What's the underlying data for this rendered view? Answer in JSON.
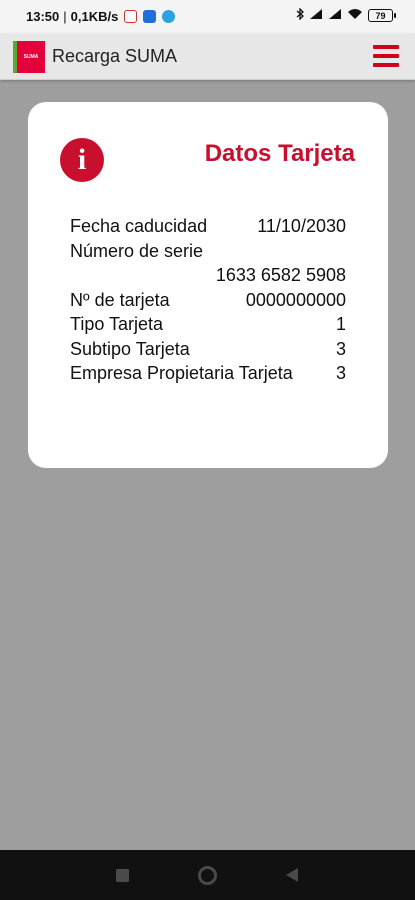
{
  "status_bar": {
    "time": "13:50",
    "separator": "|",
    "speed": "0,1KB/s",
    "battery": "79",
    "icons": [
      "gmail-icon",
      "outlook-icon",
      "telegram-icon",
      "bluetooth-icon",
      "signal-icon",
      "signal-icon",
      "wifi-icon",
      "battery-icon"
    ]
  },
  "app_bar": {
    "logo_text": "SUMA",
    "title": "Recarga SUMA",
    "menu_icon": "hamburger-menu-icon"
  },
  "card": {
    "icon": "info-icon",
    "icon_glyph": "i",
    "title": "Datos Tarjeta",
    "rows": [
      {
        "label": "Fecha caducidad",
        "value": "11/10/2030"
      },
      {
        "label": "Número de serie",
        "value": ""
      },
      {
        "label": "",
        "value": "1633 6582 5908"
      },
      {
        "label": "Nº de tarjeta",
        "value": "0000000000"
      },
      {
        "label": "Tipo Tarjeta",
        "value": "1"
      },
      {
        "label": "Subtipo Tarjeta",
        "value": "3"
      },
      {
        "label": "Empresa Propietaria Tarjeta",
        "value": "3"
      }
    ]
  },
  "colors": {
    "accent": "#c8102e",
    "background": "#9e9e9e",
    "card": "#ffffff",
    "app_bar": "#e7e7e7"
  },
  "nav_bar": {
    "icons": [
      "recents-square-icon",
      "home-circle-icon",
      "back-triangle-icon"
    ]
  }
}
